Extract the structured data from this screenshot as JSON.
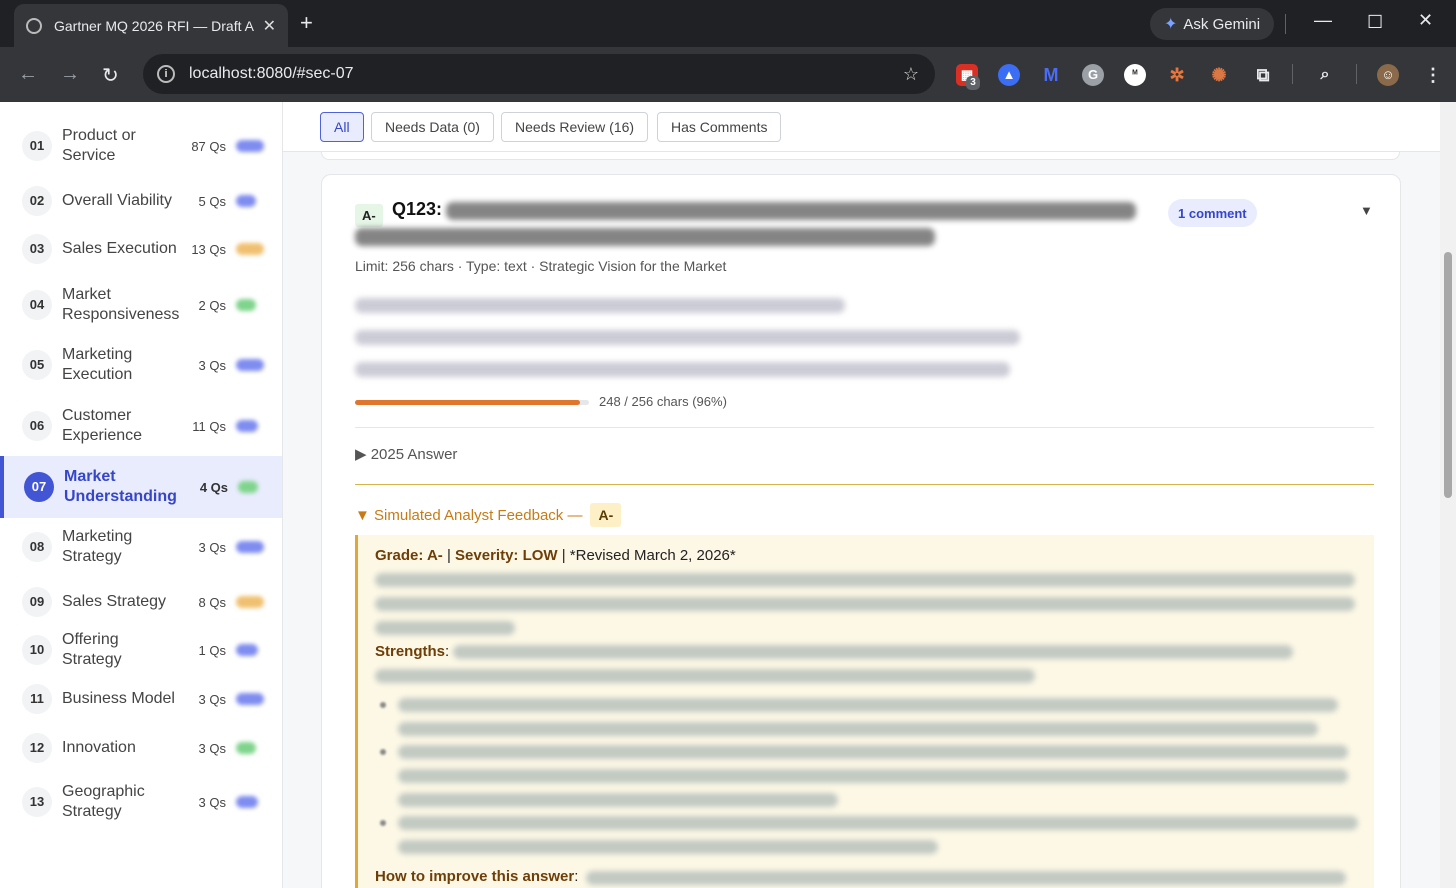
{
  "browser": {
    "tab_title": "Gartner MQ 2026 RFI — Draft A",
    "url": "localhost:8080/#sec-07",
    "gemini_label": "Ask Gemini",
    "ext_badge": "3"
  },
  "sidebar": {
    "items": [
      {
        "num": "01",
        "label": "Product or Service",
        "qs": "87 Qs",
        "color": "#7f8cf0"
      },
      {
        "num": "02",
        "label": "Overall Viability",
        "qs": "5 Qs",
        "color": "#7f8cf0"
      },
      {
        "num": "03",
        "label": "Sales Execution",
        "qs": "13 Qs",
        "color": "#f0c070"
      },
      {
        "num": "04",
        "label": "Market Responsiveness",
        "qs": "2 Qs",
        "color": "#7fd48c"
      },
      {
        "num": "05",
        "label": "Marketing Execution",
        "qs": "3 Qs",
        "color": "#7f8cf0"
      },
      {
        "num": "06",
        "label": "Customer Experience",
        "qs": "11 Qs",
        "color": "#7f8cf0"
      },
      {
        "num": "07",
        "label": "Market Understanding",
        "qs": "4 Qs",
        "color": "#7fd48c"
      },
      {
        "num": "08",
        "label": "Marketing Strategy",
        "qs": "3 Qs",
        "color": "#7f8cf0"
      },
      {
        "num": "09",
        "label": "Sales Strategy",
        "qs": "8 Qs",
        "color": "#f0c070"
      },
      {
        "num": "10",
        "label": "Offering Strategy",
        "qs": "1 Qs",
        "color": "#7f8cf0"
      },
      {
        "num": "11",
        "label": "Business Model",
        "qs": "3 Qs",
        "color": "#7f8cf0"
      },
      {
        "num": "12",
        "label": "Innovation",
        "qs": "3 Qs",
        "color": "#7fd48c"
      },
      {
        "num": "13",
        "label": "Geographic Strategy",
        "qs": "3 Qs",
        "color": "#7f8cf0"
      }
    ]
  },
  "filters": {
    "all": "All",
    "needs_data": "Needs Data (0)",
    "needs_review": "Needs Review (16)",
    "has_comments": "Has Comments"
  },
  "question": {
    "grade": "A-",
    "id": "Q123:",
    "comment_badge": "1 comment",
    "meta": "Limit: 256 chars · Type: text · Strategic Vision for the Market",
    "progress_text": "248 / 256 chars (96%)",
    "progress": 0.96,
    "prev_answer_label": "▶ 2025 Answer",
    "feedback_label": "▼ Simulated Analyst Feedback —",
    "feedback_grade": "A-",
    "grade_line_a": "Grade: A-",
    "grade_line_b": "Severity: LOW",
    "grade_line_c": " | *Revised March 2, 2026*",
    "strengths_label": "Strengths",
    "improve_label": "How to improve this answer"
  },
  "colors": {
    "accent": "#4255d4",
    "feedback": "#c87b14",
    "progress": "#e0762e"
  }
}
